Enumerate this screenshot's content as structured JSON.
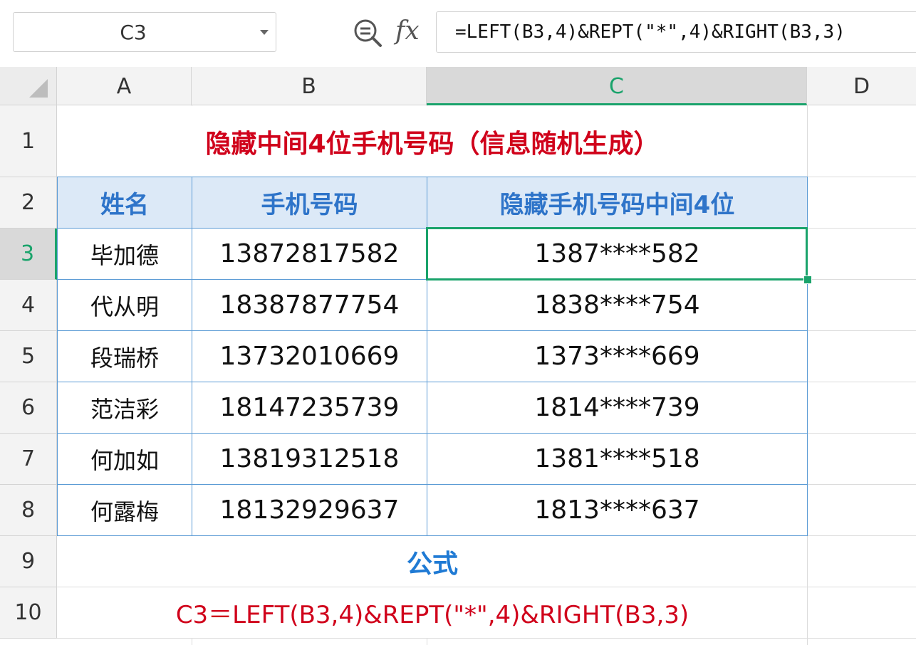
{
  "formula_bar": {
    "name_box": "C3",
    "fx_symbol": "fx",
    "formula": "=LEFT(B3,4)&REPT(\"*\",4)&RIGHT(B3,3)"
  },
  "columns": [
    "A",
    "B",
    "C",
    "D"
  ],
  "rows": [
    "1",
    "2",
    "3",
    "4",
    "5",
    "6",
    "7",
    "8",
    "9",
    "10"
  ],
  "sheet": {
    "title": "隐藏中间4位手机号码（信息随机生成）",
    "headers": [
      "姓名",
      "手机号码",
      "隐藏手机号码中间4位"
    ],
    "records": [
      {
        "name": "毕加德",
        "phone": "13872817582",
        "masked": "1387****582"
      },
      {
        "name": "代从明",
        "phone": "18387877754",
        "masked": "1838****754"
      },
      {
        "name": "段瑞桥",
        "phone": "13732010669",
        "masked": "1373****669"
      },
      {
        "name": "范洁彩",
        "phone": "18147235739",
        "masked": "1814****739"
      },
      {
        "name": "何加如",
        "phone": "13819312518",
        "masked": "1381****518"
      },
      {
        "name": "何露梅",
        "phone": "18132929637",
        "masked": "1813****637"
      }
    ],
    "formula_label": "公式",
    "formula_note": "C3＝LEFT(B3,4)&REPT(\"*\",4)&RIGHT(B3,3)"
  },
  "selected_column": "C",
  "selected_row": "3",
  "accent_color": "#1aa36b",
  "title_color": "#d0021b",
  "header_color": "#2e74c9"
}
